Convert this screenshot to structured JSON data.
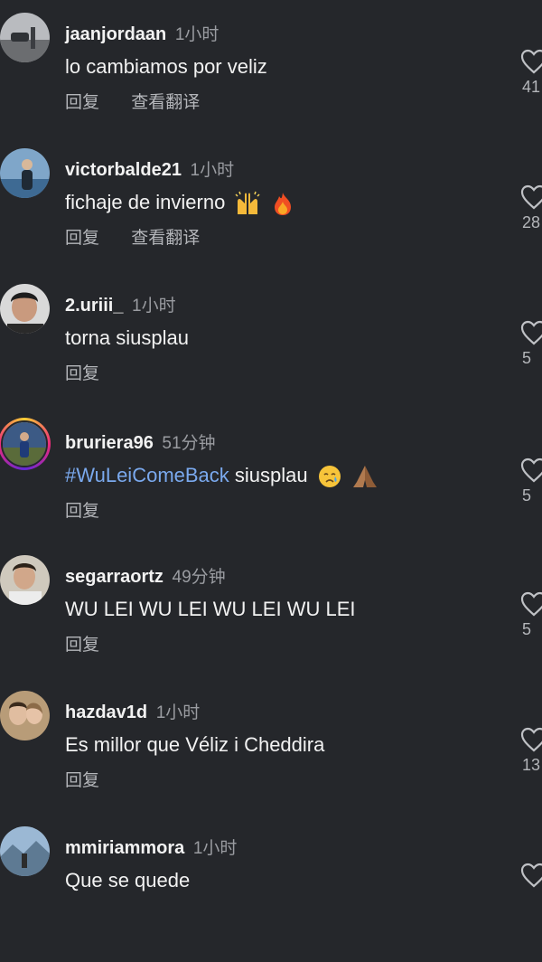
{
  "comments": [
    {
      "user": "jaanjordaan",
      "time": "1小时",
      "text": "lo cambiamos por veliz",
      "reply": "回复",
      "translate": "查看翻译",
      "likes": "41"
    },
    {
      "user": "victorbalde21",
      "time": "1小时",
      "text": "fichaje de invierno",
      "emojis": [
        "raising-hands",
        "fire"
      ],
      "reply": "回复",
      "translate": "查看翻译",
      "likes": "28"
    },
    {
      "user": "2.uriii_",
      "time": "1小时",
      "text": "torna siusplau",
      "reply": "回复",
      "likes": "5"
    },
    {
      "user": "bruriera96",
      "time": "51分钟",
      "hashtag": "#WuLeiComeBack",
      "text": " siusplau",
      "emojis": [
        "crying-face",
        "folded-hands"
      ],
      "reply": "回复",
      "likes": "5"
    },
    {
      "user": "segarraortz",
      "time": "49分钟",
      "text": "WU LEI WU LEI WU LEI WU LEI",
      "reply": "回复",
      "likes": "5"
    },
    {
      "user": "hazdav1d",
      "time": "1小时",
      "text": "Es millor que Véliz i Cheddira",
      "reply": "回复",
      "likes": "13"
    },
    {
      "user": "mmiriammora",
      "time": "1小时",
      "text": "Que se quede"
    }
  ],
  "icons": {
    "like": "heart-outline-icon"
  },
  "colors": {
    "background": "#25272b",
    "hashtag": "#7aa9ee",
    "muted": "#9a9ca1"
  }
}
